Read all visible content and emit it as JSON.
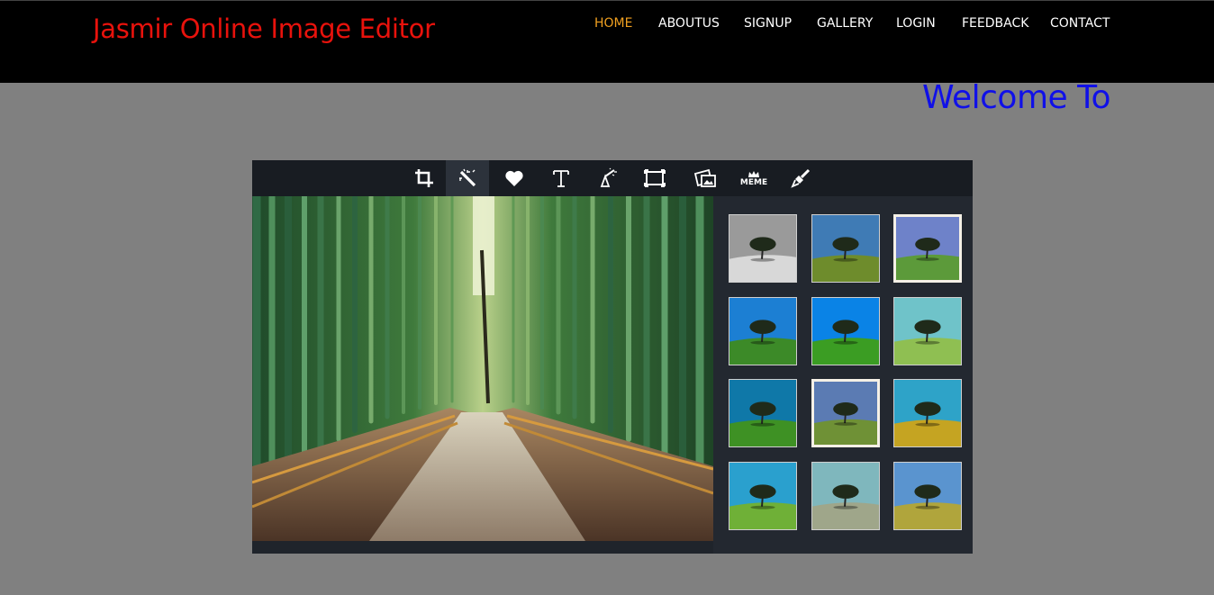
{
  "site": {
    "title": "Jasmir Online Image Editor",
    "nav": [
      {
        "label": "HOME",
        "active": true
      },
      {
        "label": "ABOUTUS",
        "active": false
      },
      {
        "label": "SIGNUP",
        "active": false
      },
      {
        "label": "GALLERY",
        "active": false
      },
      {
        "label": "LOGIN",
        "active": false
      },
      {
        "label": "FEEDBACK",
        "active": false
      },
      {
        "label": "CONTACT",
        "active": false
      }
    ],
    "marquee": "Welcome To Online Image Editor"
  },
  "editor": {
    "tools": [
      {
        "icon": "crop-icon",
        "active": false
      },
      {
        "icon": "magic-wand-icon",
        "active": true
      },
      {
        "icon": "heart-icon",
        "active": false
      },
      {
        "icon": "text-icon",
        "active": false
      },
      {
        "icon": "wizard-icon",
        "active": false
      },
      {
        "icon": "frame-icon",
        "active": false
      },
      {
        "icon": "photo-overlay-icon",
        "active": false
      },
      {
        "icon": "meme-icon",
        "active": false
      },
      {
        "icon": "brush-icon",
        "active": false
      }
    ],
    "meme_label": "MEME",
    "filters": [
      {
        "name": "grayscale",
        "sky": "#9a9a9a",
        "ground": "#d8d8d8"
      },
      {
        "name": "normal",
        "sky": "#3f7bb5",
        "ground": "#6e8c2c"
      },
      {
        "name": "faded-frame",
        "sky": "#6e82c9",
        "ground": "#5c9a3a"
      },
      {
        "name": "vivid",
        "sky": "#1c7fd3",
        "ground": "#3c8a28"
      },
      {
        "name": "deep-blue",
        "sky": "#0a83e6",
        "ground": "#3b9d23"
      },
      {
        "name": "pale",
        "sky": "#6fc3c9",
        "ground": "#8fbf52"
      },
      {
        "name": "vignette",
        "sky": "#0f78a8",
        "ground": "#3e9124"
      },
      {
        "name": "vintage-frame",
        "sky": "#5b7bb3",
        "ground": "#6f9136"
      },
      {
        "name": "psychedelic",
        "sky": "#2ea3c8",
        "ground": "#c5a422"
      },
      {
        "name": "soft-glow",
        "sky": "#2aa0ce",
        "ground": "#6fb037"
      },
      {
        "name": "muted",
        "sky": "#7fb7bd",
        "ground": "#9fa68a"
      },
      {
        "name": "warm",
        "sky": "#5a94cf",
        "ground": "#b0a53c"
      }
    ]
  },
  "colors": {
    "brand": "#e8120c",
    "nav_active": "#f0a020",
    "marquee": "#1010e8",
    "editor_bg": "#1f242b"
  }
}
